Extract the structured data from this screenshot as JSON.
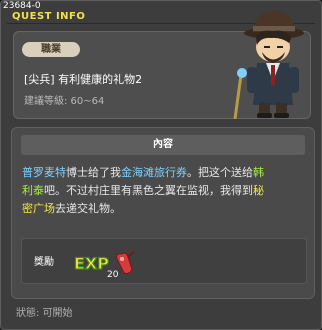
{
  "window": {
    "quest_id": "23684-0",
    "title": "QUEST INFO"
  },
  "header": {
    "job_tag": "職業",
    "quest_name": "[尖兵] 有利健康的礼物2",
    "level_range": "建議等級: 60~64"
  },
  "content": {
    "section_title": "內容",
    "description_parts": [
      {
        "text": "普罗麦特",
        "style": "hl-blue"
      },
      {
        "text": "博士给了我",
        "style": ""
      },
      {
        "text": "金海滩旅行券",
        "style": "hl-blue"
      },
      {
        "text": "。把这个送给",
        "style": ""
      },
      {
        "text": "韩\n利泰",
        "style": "hl-green"
      },
      {
        "text": "吧。不过村庄里有黑色之翼在监视，我得到",
        "style": ""
      },
      {
        "text": "秘\n密广场",
        "style": "hl-yellow"
      },
      {
        "text": "去递交礼物。",
        "style": ""
      }
    ],
    "reward": {
      "label": "獎勵",
      "exp_text": "EXP",
      "exp_count": "20"
    }
  },
  "status": {
    "text": "狀態: 可開始"
  },
  "colors": {
    "title_yellow": "#f4e14a",
    "highlight_blue": "#7fd0ff",
    "highlight_green": "#a7f03c",
    "highlight_yellow": "#f2e64b"
  }
}
